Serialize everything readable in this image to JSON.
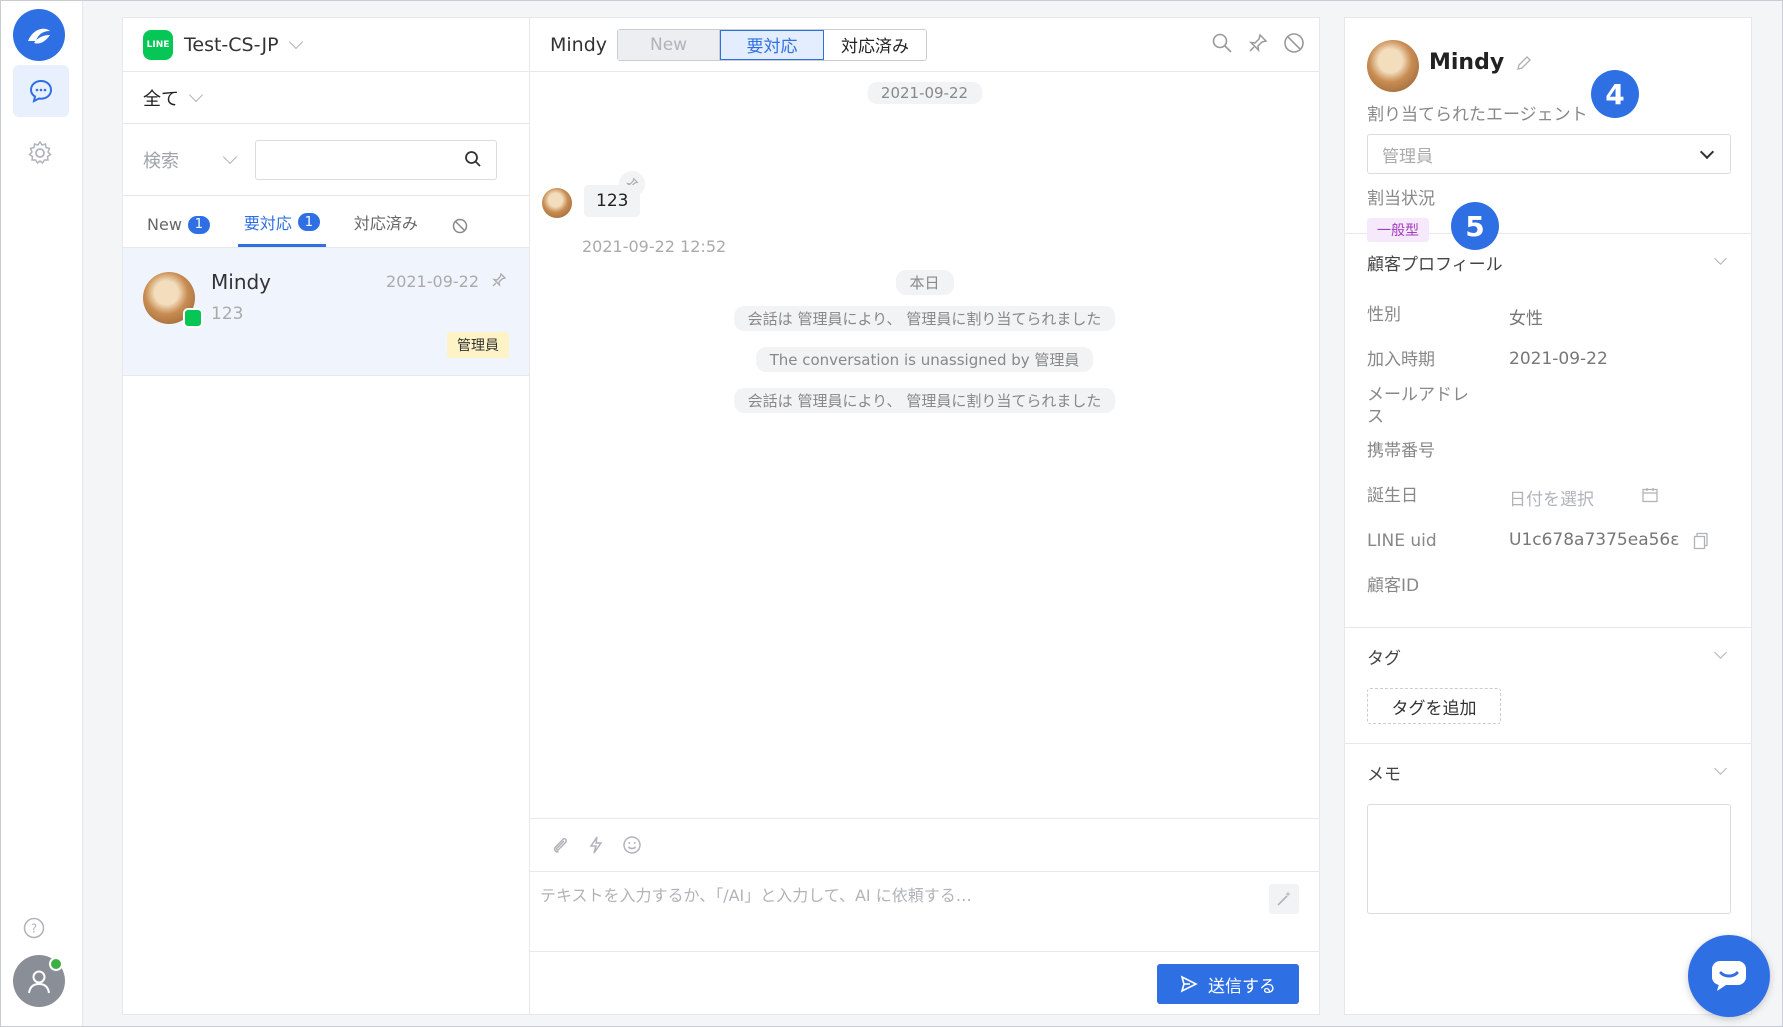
{
  "colors": {
    "accent": "#2f6fe4",
    "line_green": "#06c755",
    "status_purple": "#a43bbf",
    "tag_yellow": "#fdf3c7"
  },
  "rail": {
    "icons": [
      "app-logo-icon",
      "chat-icon",
      "gear-icon",
      "help-icon",
      "user-icon"
    ]
  },
  "list": {
    "channel": "Test-CS-JP",
    "channel_badge": "LINE",
    "filter": "全て",
    "search_label": "検索",
    "search_value": "",
    "tabs": [
      {
        "label": "New",
        "count": "1"
      },
      {
        "label": "要対応",
        "count": "1"
      },
      {
        "label": "対応済み"
      }
    ],
    "active_tab": "要対応",
    "conversations": [
      {
        "name": "Mindy",
        "preview": "123",
        "time": "2021-09-22",
        "tag": "管理員"
      }
    ]
  },
  "chat": {
    "contact": "Mindy",
    "status_buttons": [
      "New",
      "要対応",
      "対応済み"
    ],
    "selected_status": "要対応",
    "date_divider": "2021-09-22",
    "message": {
      "text": "123",
      "time": "2021-09-22 12:52"
    },
    "today_divider": "本日",
    "system_messages": [
      "会話は 管理員により、 管理員に割り当てられました",
      "The conversation is unassigned by 管理員",
      "会話は 管理員により、 管理員に割り当てられました"
    ],
    "composer_placeholder": "テキストを入力するか、「/AI」と入力して、AI に依頼する…",
    "send_label": "送信する"
  },
  "profile": {
    "name": "Mindy",
    "agent_label": "割り当てられたエージェント",
    "agent_value": "管理員",
    "status_label": "割当状況",
    "status_value": "一般型",
    "callouts": [
      "4",
      "5"
    ],
    "customer_section": "顧客プロフィール",
    "fields": [
      {
        "label": "性別",
        "value": "女性"
      },
      {
        "label": "加入時期",
        "value": "2021-09-22"
      },
      {
        "label": "メールアドレス",
        "value": ""
      },
      {
        "label": "携帯番号",
        "value": ""
      },
      {
        "label": "誕生日",
        "value": "日付を選択"
      },
      {
        "label": "LINE uid",
        "value": "U1c678a7375ea56ε"
      },
      {
        "label": "顧客ID",
        "value": ""
      }
    ],
    "tags_section": "タグ",
    "add_tag_label": "タグを追加",
    "memo_section": "メモ",
    "memo_value": ""
  }
}
